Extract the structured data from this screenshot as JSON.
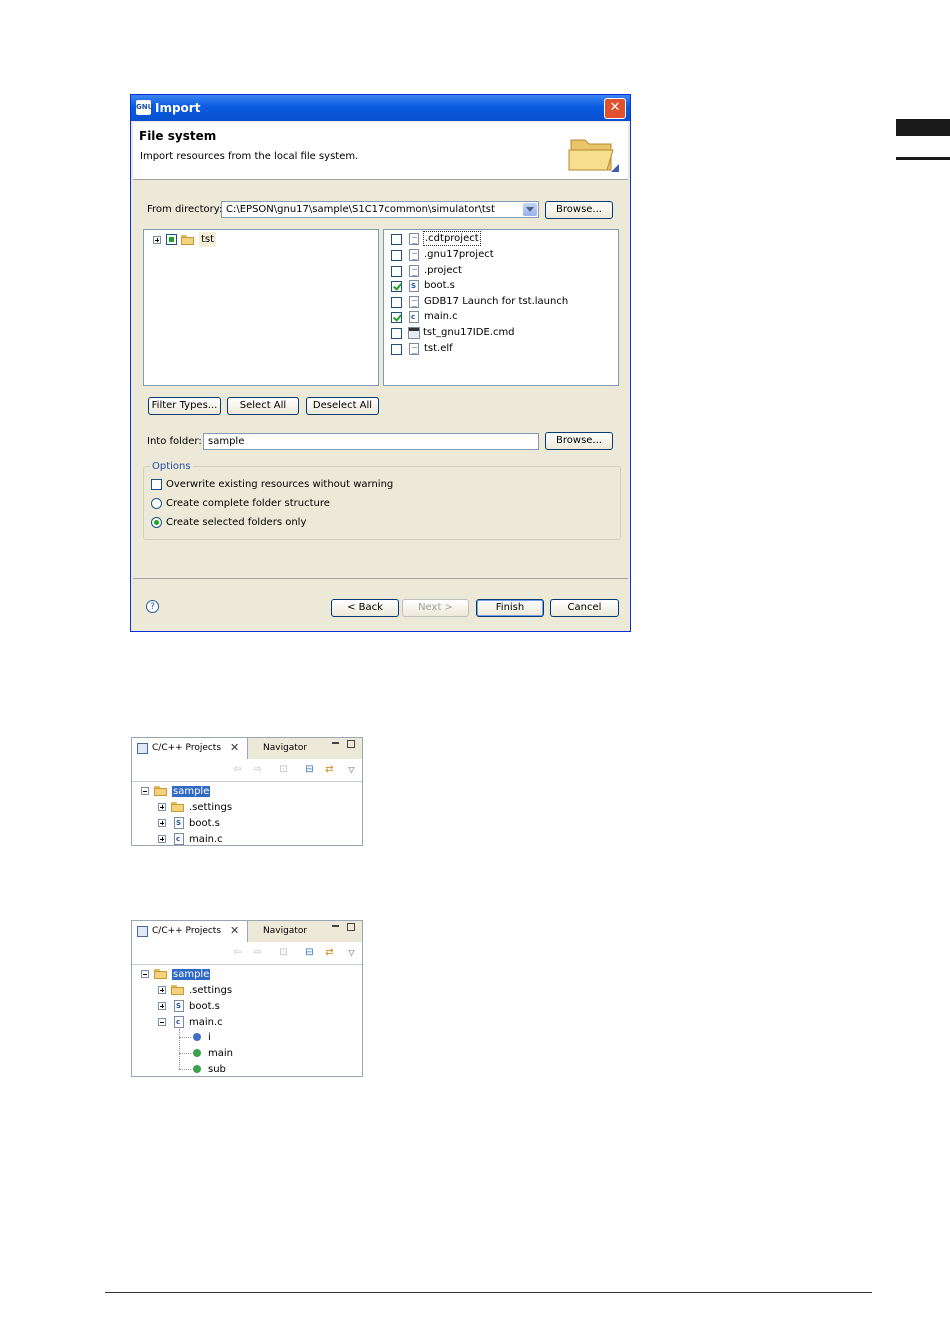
{
  "dialog": {
    "title": "Import",
    "title_icon": "GNU",
    "banner_title": "File system",
    "banner_desc": "Import resources from the local file system.",
    "from_dir_label": "From directory:",
    "from_dir_value": "C:\\EPSON\\gnu17\\sample\\S1C17common\\simulator\\tst",
    "browse_label": "Browse...",
    "tree_root": "tst",
    "files": [
      {
        "name": ".cdtproject",
        "checked": false,
        "icon": "text-file-icon"
      },
      {
        "name": ".gnu17project",
        "checked": false,
        "icon": "text-file-icon"
      },
      {
        "name": ".project",
        "checked": false,
        "icon": "text-file-icon"
      },
      {
        "name": "boot.s",
        "checked": true,
        "icon": "asm-file-icon"
      },
      {
        "name": "GDB17 Launch for tst.launch",
        "checked": false,
        "icon": "text-file-icon"
      },
      {
        "name": "main.c",
        "checked": true,
        "icon": "c-file-icon"
      },
      {
        "name": "tst_gnu17IDE.cmd",
        "checked": false,
        "icon": "cmd-file-icon"
      },
      {
        "name": "tst.elf",
        "checked": false,
        "icon": "text-file-icon"
      }
    ],
    "filter_types": "Filter Types...",
    "select_all": "Select All",
    "deselect_all": "Deselect All",
    "into_folder_label": "Into folder:",
    "into_folder_value": "sample",
    "options_label": "Options",
    "opt_overwrite": "Overwrite existing resources without warning",
    "opt_complete": "Create complete folder structure",
    "opt_selected": "Create selected folders only",
    "back": "< Back",
    "next": "Next >",
    "finish": "Finish",
    "cancel": "Cancel",
    "help": "?"
  },
  "view1": {
    "tab_active": "C/C++ Projects",
    "tab_other": "Navigator",
    "items": [
      {
        "label": "sample",
        "selected": true
      },
      {
        "label": ".settings"
      },
      {
        "label": "boot.s"
      },
      {
        "label": "main.c"
      }
    ]
  },
  "view2": {
    "tab_active": "C/C++ Projects",
    "tab_other": "Navigator",
    "items": [
      {
        "label": "sample",
        "selected": true
      },
      {
        "label": ".settings"
      },
      {
        "label": "boot.s"
      },
      {
        "label": "main.c"
      }
    ],
    "members": [
      "i",
      "main",
      "sub"
    ],
    "colors": {
      "variable": "#3d6fc4",
      "function": "#3aa34a"
    }
  }
}
